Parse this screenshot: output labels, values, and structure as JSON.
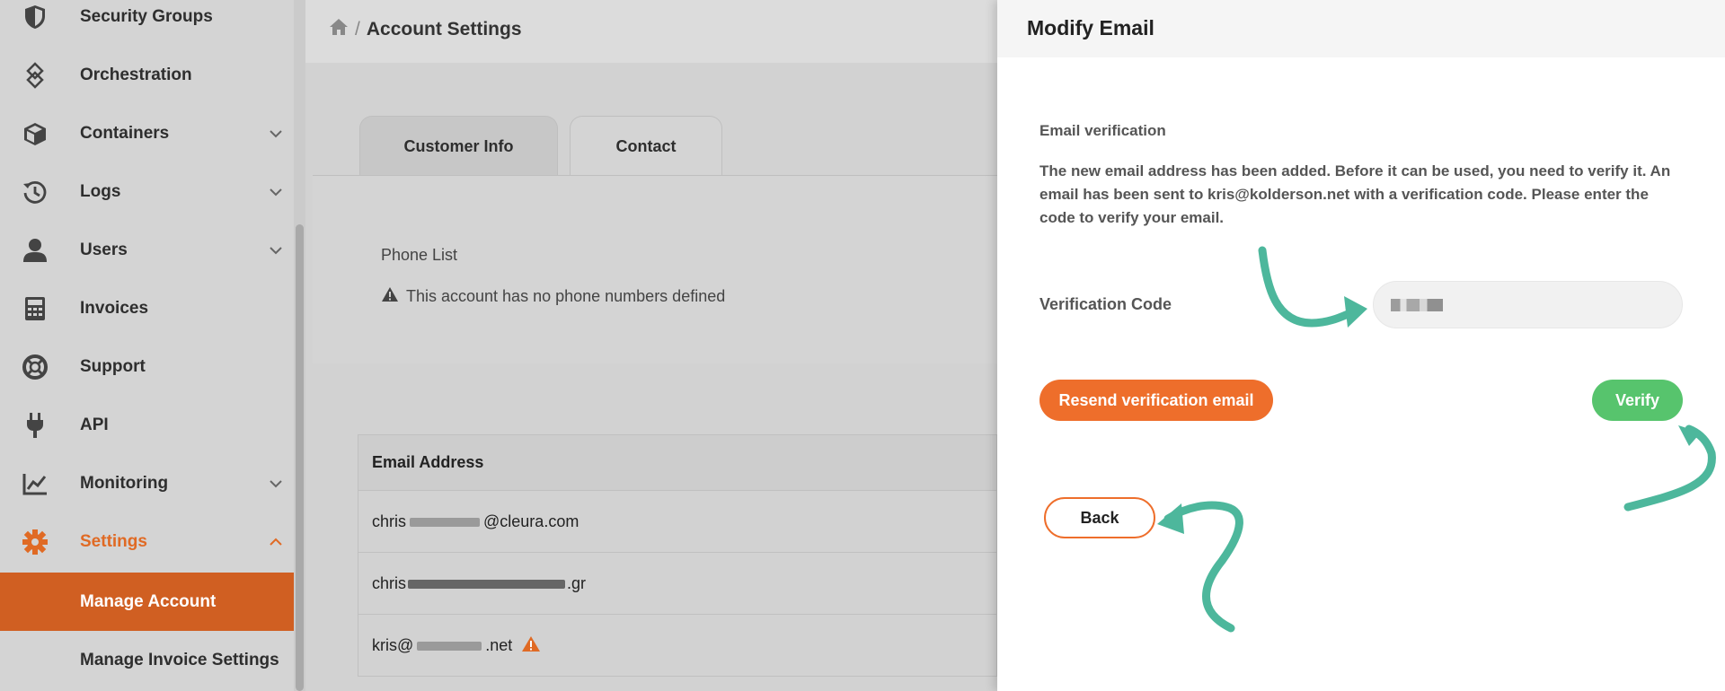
{
  "sidebar": {
    "items": [
      {
        "label": "Security Groups",
        "icon": "shield-icon"
      },
      {
        "label": "Orchestration",
        "icon": "orchestration-icon"
      },
      {
        "label": "Containers",
        "icon": "cube-icon"
      },
      {
        "label": "Logs",
        "icon": "history-icon"
      },
      {
        "label": "Users",
        "icon": "user-icon"
      },
      {
        "label": "Invoices",
        "icon": "calculator-icon"
      },
      {
        "label": "Support",
        "icon": "lifebuoy-icon"
      },
      {
        "label": "API",
        "icon": "plug-icon"
      },
      {
        "label": "Monitoring",
        "icon": "chart-icon"
      },
      {
        "label": "Settings",
        "icon": "gear-icon"
      }
    ],
    "sub_items": [
      {
        "label": "Manage Account"
      },
      {
        "label": "Manage Invoice Settings"
      }
    ]
  },
  "main": {
    "breadcrumb": {
      "current": "Account Settings",
      "separator": "/"
    },
    "tabs": [
      {
        "label": "Customer Info",
        "active": false
      },
      {
        "label": "Contact",
        "active": true
      }
    ],
    "phone": {
      "label": "Phone List",
      "empty_message": "This account has no phone numbers defined"
    },
    "email_table": {
      "header": "Email Address",
      "rows": [
        {
          "prefix": "chris",
          "suffix": "@cleura.com",
          "warning": false
        },
        {
          "prefix": "chris",
          "suffix": ".gr",
          "warning": false
        },
        {
          "prefix": "kris@",
          "suffix": ".net",
          "warning": true
        }
      ]
    }
  },
  "panel": {
    "title": "Modify Email",
    "verification_title": "Email verification",
    "verification_text": "The new email address has been added. Before it can be used, you need to verify it. An email has been sent to kris@kolderson.net with a verification code. Please enter the code to verify your email.",
    "code_label": "Verification Code",
    "code_value": "",
    "resend_label": "Resend verification email",
    "verify_label": "Verify",
    "back_label": "Back"
  },
  "colors": {
    "accent_orange": "#ee6e2b",
    "verify_green": "#57c46d",
    "annotation_teal": "#4db79c",
    "selected_sidebar": "#d05f22"
  }
}
